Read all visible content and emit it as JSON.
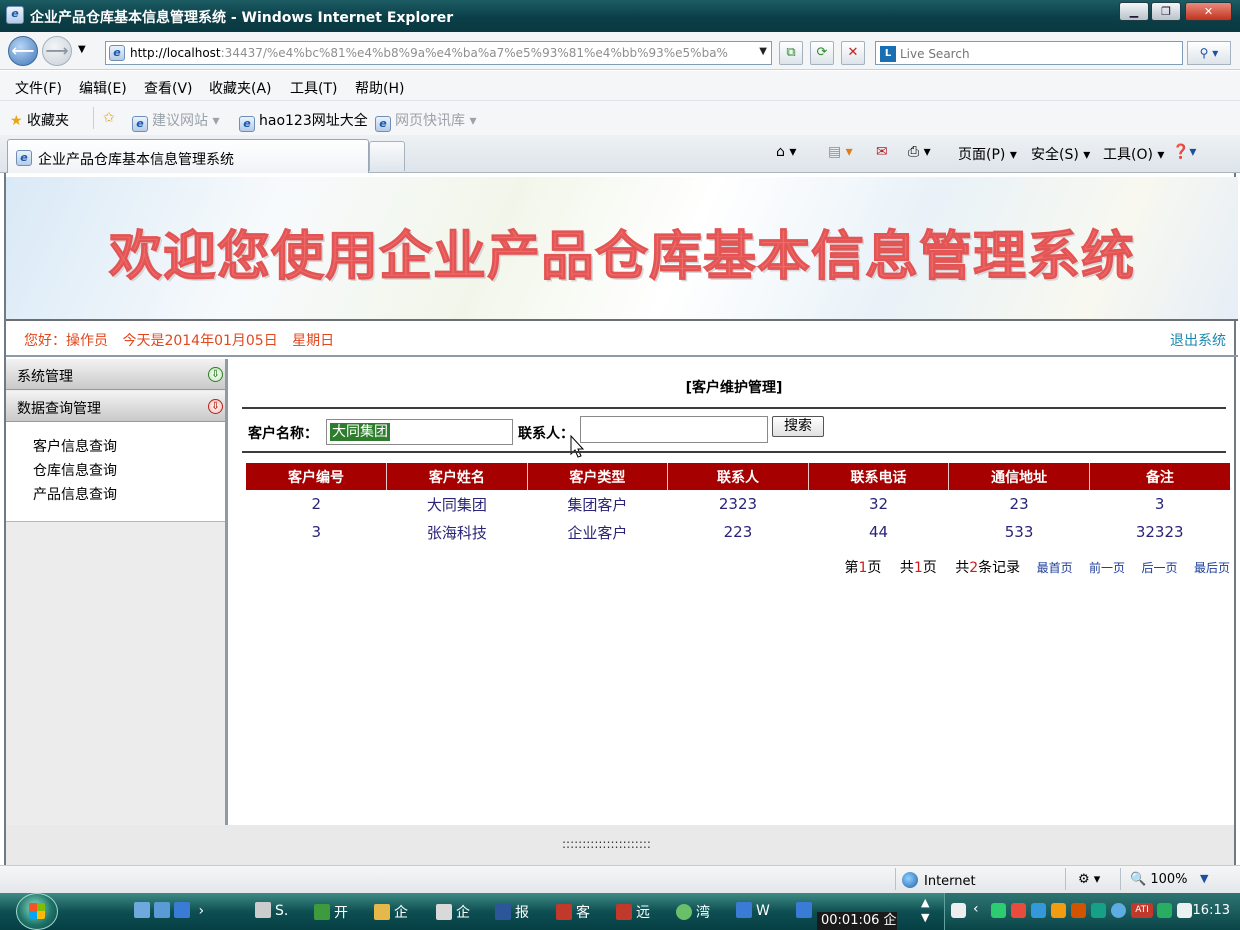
{
  "window": {
    "title": "企业产品仓库基本信息管理系统 - Windows Internet Explorer",
    "buttons": {
      "minimize": "▁",
      "maximize": "❐",
      "close": "✕"
    }
  },
  "navbar": {
    "url_host": "http://localhost",
    "url_rest": ":34437/%e4%bc%81%e4%b8%9a%e4%ba%a7%e5%93%81%e4%bb%93%e5%ba%",
    "search_placeholder": "Live Search",
    "search_logo": "Live"
  },
  "menubar": [
    "文件(F)",
    "编辑(E)",
    "查看(V)",
    "收藏夹(A)",
    "工具(T)",
    "帮助(H)"
  ],
  "favorites": {
    "label": "收藏夹",
    "items": [
      "建议网站 ▾",
      "hao123网址大全",
      "网页快讯库 ▾"
    ]
  },
  "tabs": {
    "active_title": "企业产品仓库基本信息管理系统",
    "commands": [
      "页面(P) ▾",
      "安全(S) ▾",
      "工具(O) ▾"
    ]
  },
  "banner": {
    "title": "欢迎您使用企业产品仓库基本信息管理系统"
  },
  "infobar": {
    "greeting": "您好：操作员",
    "date": "今天是2014年01月05日",
    "weekday": "星期日",
    "logout": "退出系统"
  },
  "sidebar": {
    "sections": [
      {
        "label": "系统管理",
        "state": "collapsed"
      },
      {
        "label": "数据查询管理",
        "state": "expanded"
      }
    ],
    "items": [
      "客户信息查询",
      "仓库信息查询",
      "产品信息查询"
    ]
  },
  "main": {
    "title": "[客户维护管理]",
    "name_label": "客户名称：",
    "name_value": "大同集团",
    "contact_label": "联系人：",
    "contact_value": "",
    "search_button": "搜索",
    "table": {
      "headers": [
        "客户编号",
        "客户姓名",
        "客户类型",
        "联系人",
        "联系电话",
        "通信地址",
        "备注"
      ],
      "rows": [
        [
          "2",
          "大同集团",
          "集团客户",
          "2323",
          "32",
          "23",
          "3"
        ],
        [
          "3",
          "张海科技",
          "企业客户",
          "223",
          "44",
          "533",
          "32323"
        ]
      ],
      "header_color": "#a60000"
    },
    "pager": {
      "page_prefix": "第",
      "page_num": "1",
      "page_suffix": "页",
      "total_prefix": "共",
      "total_pages": "1",
      "total_suffix": "页",
      "records_prefix": "共",
      "records": "2",
      "records_suffix": "条记录",
      "first": "最首页",
      "prev": "前一页",
      "next": "后一页",
      "last": "最后页"
    }
  },
  "footer": {
    "dots": "::::::::::::::::::::::"
  },
  "statusbar": {
    "zone": "Internet",
    "zoom": "🔍 100%"
  },
  "taskbar": {
    "items": [
      "S.",
      "开",
      "企",
      "企",
      "报",
      "客",
      "远",
      "湾",
      "W",
      "企"
    ],
    "recording": "00:01:06",
    "time": "16:13"
  }
}
